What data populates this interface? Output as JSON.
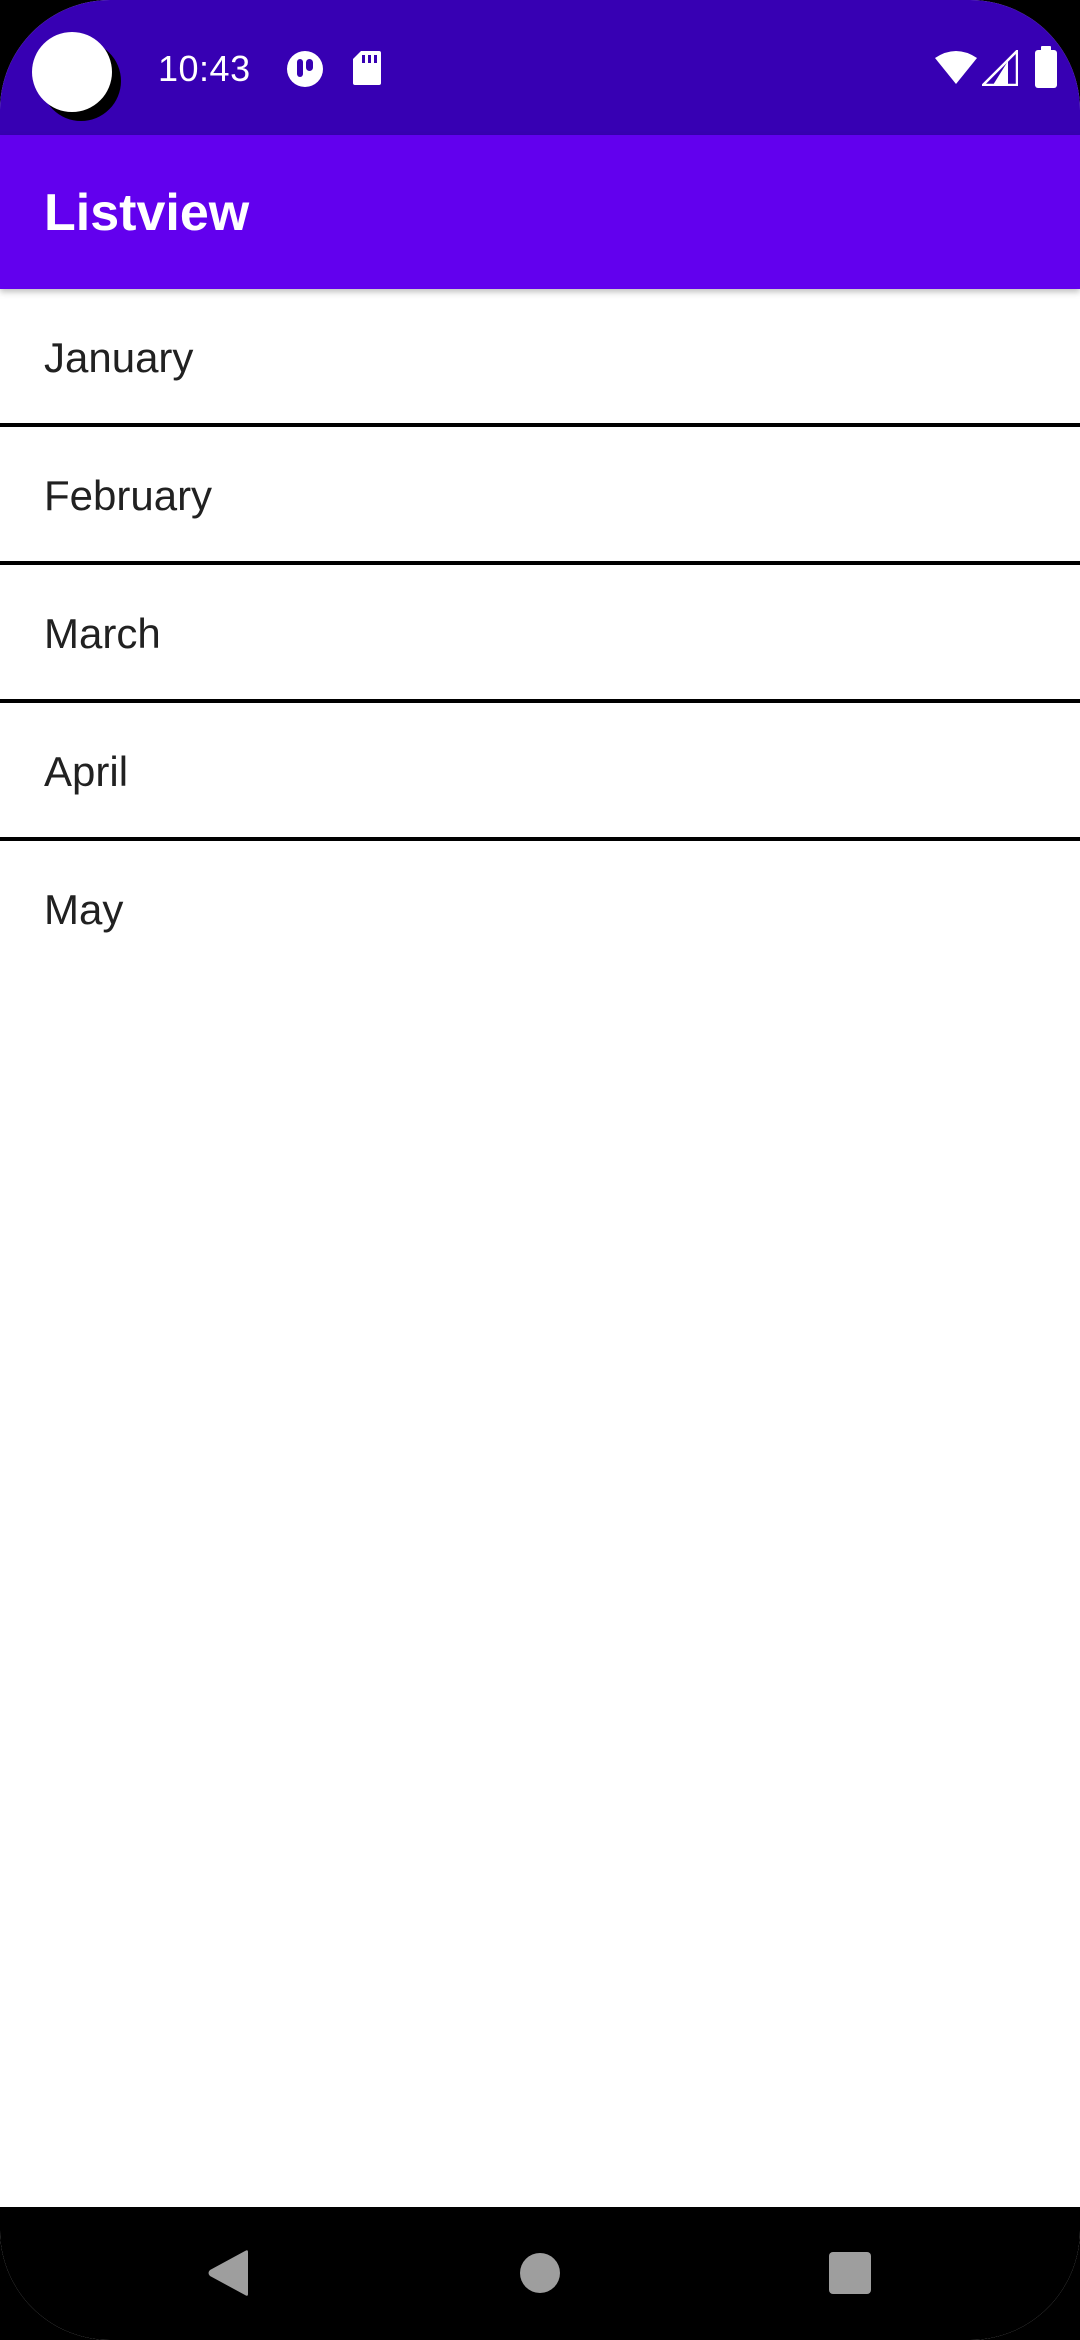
{
  "status_bar": {
    "time": "10:43",
    "icons": [
      "moon-face-icon",
      "sd-card-icon",
      "wifi-icon",
      "cellular-signal-icon",
      "battery-icon"
    ],
    "background": "#3700b3"
  },
  "app_bar": {
    "title": "Listview",
    "background": "#6200ee"
  },
  "list": {
    "items": [
      {
        "label": "January"
      },
      {
        "label": "February"
      },
      {
        "label": "March"
      },
      {
        "label": "April"
      },
      {
        "label": "May"
      }
    ],
    "divider_color": "#000000"
  },
  "nav_bar": {
    "buttons": [
      "back-icon",
      "home-icon",
      "recents-icon"
    ],
    "icon_color": "#9e9e9e"
  }
}
